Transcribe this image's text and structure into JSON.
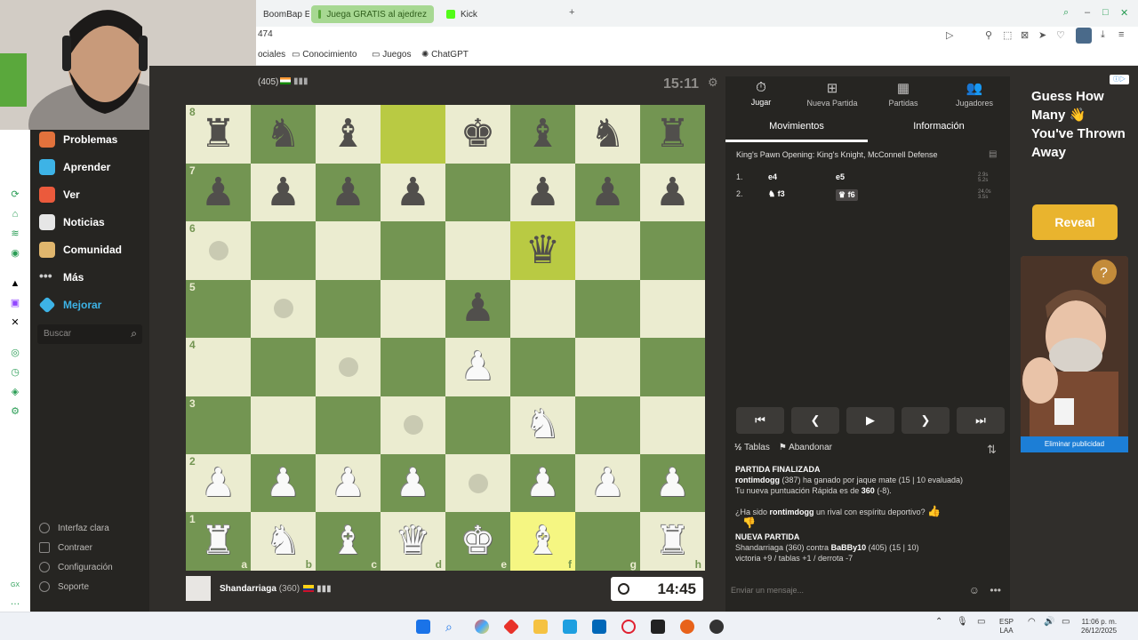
{
  "browser": {
    "tabs": [
      {
        "label": "BoomBap E",
        "active": false
      },
      {
        "label": "Juega GRATIS al ajedrez",
        "active": true
      },
      {
        "label": "Kick",
        "active": false
      }
    ],
    "address": "474",
    "bookmarks": [
      "ociales",
      "Conocimiento",
      "Juegos",
      "ChatGPT"
    ]
  },
  "sidebar": {
    "items": [
      {
        "label": "Problemas",
        "color": "#e2723c"
      },
      {
        "label": "Aprender",
        "color": "#3db3e6"
      },
      {
        "label": "Ver",
        "color": "#eb5a3c"
      },
      {
        "label": "Noticias",
        "color": "#e6e6e6"
      },
      {
        "label": "Comunidad",
        "color": "#e0b66d"
      },
      {
        "label": "Más",
        "color": "#cccccc"
      },
      {
        "label": "Mejorar",
        "color": "#3db3e6"
      }
    ],
    "search_placeholder": "Buscar",
    "footer": [
      "Interfaz clara",
      "Contraer",
      "Configuración",
      "Soporte"
    ]
  },
  "opponent": {
    "rating": "(405)",
    "clock": "15:11"
  },
  "player": {
    "name": "Shandarriaga",
    "rating": "(360)",
    "clock": "14:45"
  },
  "board": {
    "ranks": [
      "8",
      "7",
      "6",
      "5",
      "4",
      "3",
      "2",
      "1"
    ],
    "files": [
      "a",
      "b",
      "c",
      "d",
      "e",
      "f",
      "g",
      "h"
    ],
    "rows": [
      [
        "r",
        "n",
        "b",
        "",
        "k",
        "b",
        "n",
        "r"
      ],
      [
        "p",
        "p",
        "p",
        "p",
        "",
        "p",
        "p",
        "p"
      ],
      [
        "",
        "",
        "",
        "",
        "",
        "q",
        "",
        ""
      ],
      [
        "",
        "",
        "",
        "",
        "p",
        "",
        "",
        ""
      ],
      [
        "",
        "",
        "",
        "",
        "P",
        "",
        "",
        ""
      ],
      [
        "",
        "",
        "",
        "",
        "",
        "N",
        "",
        ""
      ],
      [
        "P",
        "P",
        "P",
        "P",
        "",
        "P",
        "P",
        "P"
      ],
      [
        "R",
        "N",
        "B",
        "Q",
        "K",
        "B",
        "",
        "R"
      ]
    ],
    "highlights": {
      "6-f": "green",
      "8-d": "green",
      "1-f": "yellow"
    },
    "hints": [
      "6-a",
      "5-b",
      "4-c",
      "3-d",
      "2-e"
    ]
  },
  "panel": {
    "tabs": [
      {
        "label": "Jugar",
        "icon": "stopwatch-icon",
        "active": true
      },
      {
        "label": "Nueva Partida",
        "icon": "plus-icon",
        "active": false
      },
      {
        "label": "Partidas",
        "icon": "board-icon",
        "active": false
      },
      {
        "label": "Jugadores",
        "icon": "players-icon",
        "active": false
      }
    ],
    "subtabs": [
      "Movimientos",
      "Información"
    ],
    "opening": "King's Pawn Opening: King's Knight, McConnell Defense",
    "moves": [
      {
        "n": "1.",
        "white": "e4",
        "black": "e5",
        "times": "2.9s 5.2s"
      },
      {
        "n": "2.",
        "white": "f3",
        "black": "f6",
        "times": "24.0s 3.5s"
      }
    ],
    "actions": [
      "Tablas",
      "Abandonar"
    ],
    "chat": {
      "finished_title": "PARTIDA FINALIZADA",
      "result_user": "rontimdogg",
      "result_text": " (387) ha ganado por jaque mate (15 | 10 evaluada)",
      "rating_text": "Tu nueva puntuación Rápida es de ",
      "rating_value": "360",
      "rating_delta": " (-8).",
      "sportsman_pre": "¿Ha sido ",
      "sportsman_user": "rontimdogg",
      "sportsman_post": " un rival con espíritu deportivo?",
      "new_title": "NUEVA PARTIDA",
      "new_pre": "Shandarriaga (360) contra ",
      "new_opp": "BaBBy10",
      "new_post": " (405) (15 | 10)",
      "stats": "victoria +9 / tablas +1 / derrota -7"
    },
    "message_placeholder": "Enviar un mensaje..."
  },
  "ad": {
    "title": "Guess How Many 👋 You've Thrown Away",
    "button": "Reveal",
    "remove": "Eliminar publicidad"
  },
  "taskbar": {
    "lang": "ESP",
    "lang2": "LAA",
    "time": "11:06 p. m.",
    "date": "26/12/2025"
  }
}
